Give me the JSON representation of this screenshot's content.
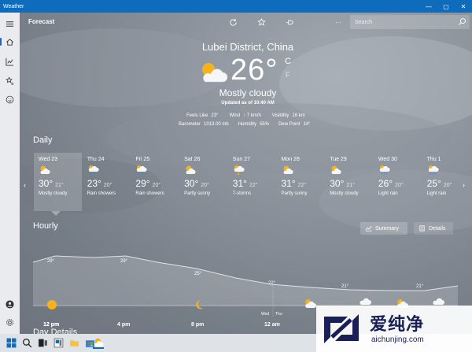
{
  "window": {
    "title": "Weather",
    "controls": [
      "—",
      "▢",
      "✕"
    ]
  },
  "rail": {
    "items": [
      "menu",
      "forecast",
      "maps",
      "historical",
      "favorites",
      "news"
    ]
  },
  "topbar": {
    "app_name": "Forecast",
    "search_placeholder": "Search",
    "more": "···"
  },
  "current": {
    "location": "Lubei District, China",
    "temperature": "26°",
    "unit_c": "C",
    "unit_f": "F",
    "condition": "Mostly cloudy",
    "updated": "Updated as of 10:40 AM",
    "feels_like_label": "Feels Like",
    "feels_like": "23°",
    "wind_label": "Wind",
    "wind": "↑ 7 km/h",
    "visibility_label": "Visibility",
    "visibility": "16 km",
    "barometer_label": "Barometer",
    "barometer": "1013.00 mb",
    "humidity_label": "Humidity",
    "humidity": "55%",
    "dew_label": "Dew Point",
    "dew": "14°"
  },
  "daily": {
    "title": "Daily",
    "days": [
      {
        "name": "Wed 23",
        "hi": "30°",
        "lo": "21°",
        "cond": "Mostly cloudy",
        "icon": "partly-cloudy"
      },
      {
        "name": "Thu 24",
        "hi": "23°",
        "lo": "20°",
        "cond": "Rain showers",
        "icon": "rain"
      },
      {
        "name": "Fri 25",
        "hi": "29°",
        "lo": "20°",
        "cond": "Rain showers",
        "icon": "rain"
      },
      {
        "name": "Sat 26",
        "hi": "30°",
        "lo": "20°",
        "cond": "Partly sunny",
        "icon": "partly-cloudy"
      },
      {
        "name": "Sun 27",
        "hi": "31°",
        "lo": "22°",
        "cond": "T-storms",
        "icon": "storm"
      },
      {
        "name": "Mon 28",
        "hi": "31°",
        "lo": "22°",
        "cond": "Partly sunny",
        "icon": "partly-cloudy"
      },
      {
        "name": "Tue 29",
        "hi": "30°",
        "lo": "21°",
        "cond": "Mostly cloudy",
        "icon": "partly-cloudy"
      },
      {
        "name": "Wed 30",
        "hi": "26°",
        "lo": "20°",
        "cond": "Light rain",
        "icon": "rain"
      },
      {
        "name": "Thu 1",
        "hi": "25°",
        "lo": "20°",
        "cond": "Light rain",
        "icon": "rain"
      }
    ]
  },
  "hourly": {
    "title": "Hourly",
    "summary_label": "Summary",
    "details_label": "Details",
    "temps": [
      "29°",
      "29°",
      "25°",
      "22°",
      "21°",
      "21°"
    ],
    "times": [
      "12 pm",
      "4 pm",
      "8 pm",
      "12 am"
    ],
    "divider_left": "Wed",
    "divider_right": "Thu"
  },
  "day_details_title": "Day Details",
  "colors": {
    "accent": "#0f6cbd",
    "sun": "#f6b21b"
  },
  "watermark": {
    "text": "爱纯净",
    "url": "aichunjing.com"
  }
}
